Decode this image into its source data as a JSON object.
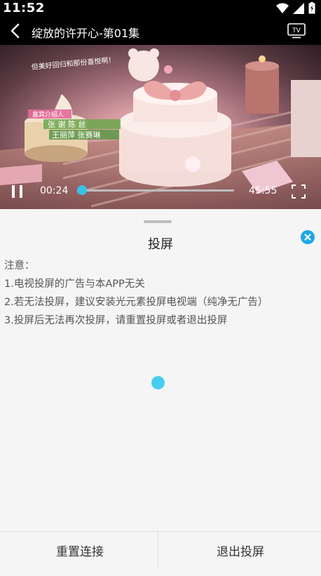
{
  "status_bar": {
    "time": "11:52"
  },
  "title_bar": {
    "title": "绽放的许开心-第01集"
  },
  "video": {
    "caption_top": "但美好回归和那份喜悦啊！",
    "credits_header": "嘉宾介绍人",
    "credits_row1": "张  谢  陈  丝",
    "credits_row2": "王丽萍  张赛琳"
  },
  "player": {
    "current_time": "00:24",
    "total_time": "45:55",
    "progress_fraction": 0.005,
    "accent": "#39c1e6"
  },
  "sheet": {
    "title": "投屏",
    "notes": [
      "注意：",
      "1.电视投屏的广告与本APP无关",
      "2.若无法投屏，建议安装光元素投屏电视端（纯净无广告）",
      "3.投屏后无法再次投屏，请重置投屏或者退出投屏"
    ],
    "reset_label": "重置连接",
    "exit_label": "退出投屏"
  }
}
